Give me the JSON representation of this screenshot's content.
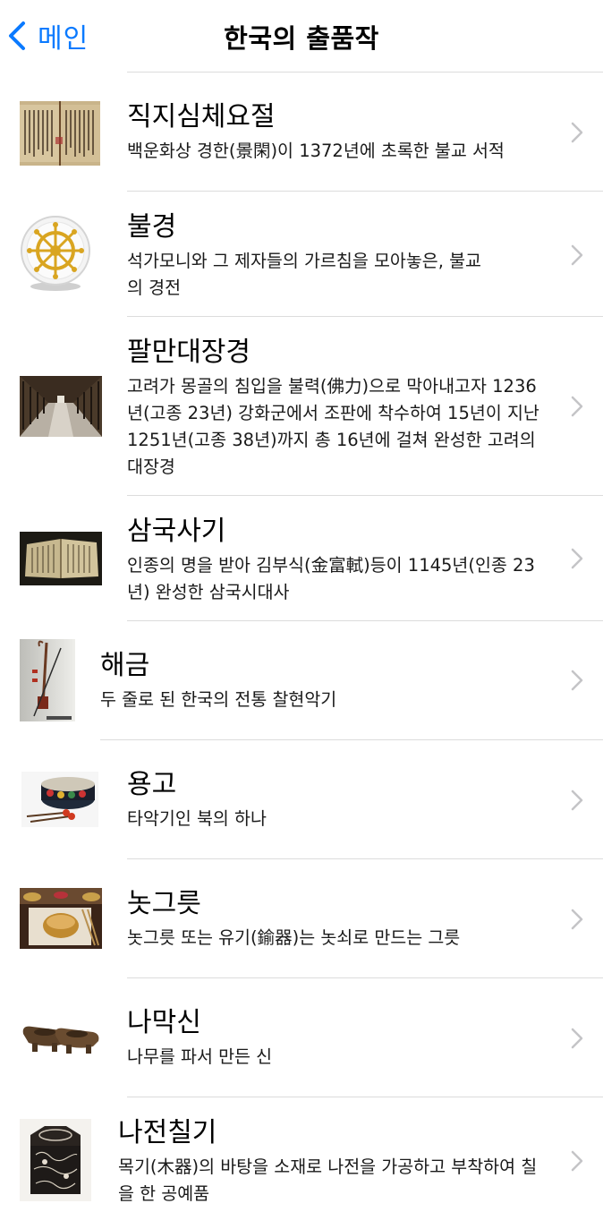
{
  "nav": {
    "back_label": "메인",
    "title": "한국의 출품작"
  },
  "items": [
    {
      "title": "직지심체요절",
      "subtitle": "백운화상 경한(景閑)이 1372년에 초록한 불교 서적"
    },
    {
      "title": "불경",
      "subtitle": "석가모니와 그 제자들의 가르침을 모아놓은, 불교의 경전"
    },
    {
      "title": "팔만대장경",
      "subtitle": "고려가 몽골의 침입을 불력(佛力)으로 막아내고자 1236년(고종 23년) 강화군에서 조판에 착수하여 15년이 지난 1251년(고종 38년)까지 총 16년에 걸쳐 완성한 고려의 대장경"
    },
    {
      "title": "삼국사기",
      "subtitle": "인종의 명을 받아 김부식(金富軾)등이 1145년(인종 23년) 완성한 삼국시대사"
    },
    {
      "title": "해금",
      "subtitle": "두 줄로 된 한국의 전통 찰현악기"
    },
    {
      "title": "용고",
      "subtitle": "타악기인 북의 하나"
    },
    {
      "title": "놋그릇",
      "subtitle": "놋그릇 또는 유기(鍮器)는 놋쇠로 만드는 그릇"
    },
    {
      "title": "나막신",
      "subtitle": "나무를 파서 만든 신"
    },
    {
      "title": "나전칠기",
      "subtitle": "목기(木器)의 바탕을 소재로 나전을 가공하고 부착하여 칠을 한 공예품"
    }
  ]
}
